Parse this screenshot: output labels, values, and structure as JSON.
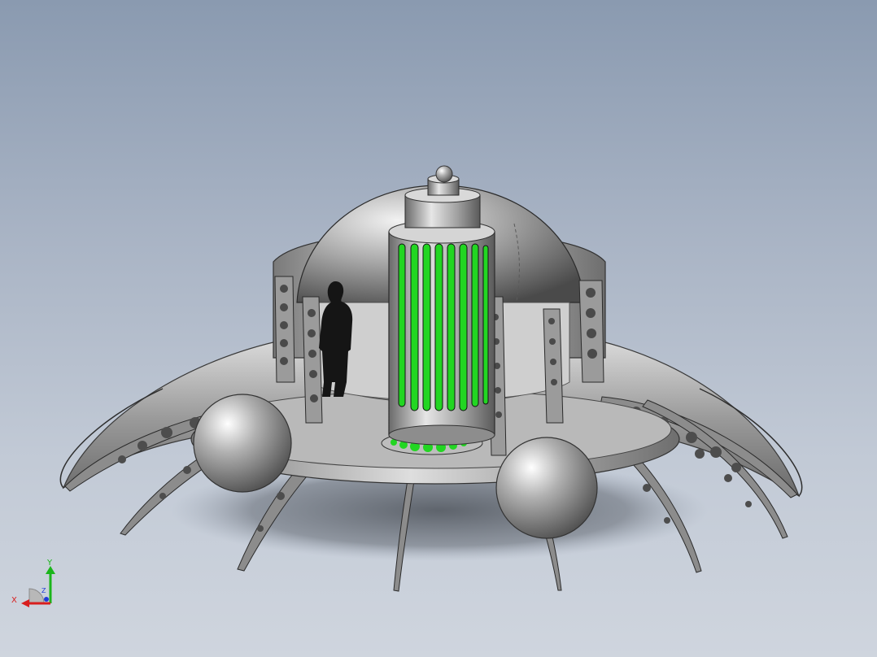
{
  "view": {
    "background_top": "#8a9ab0",
    "background_bottom": "#cfd5de",
    "model_color": "#8f8f8f",
    "core_glow_color": "#22d622"
  },
  "triad": {
    "x_label": "X",
    "y_label": "Y",
    "z_label": "Z",
    "x_color": "#d81e1e",
    "y_color": "#1bb51b",
    "z_color": "#1e3cd8"
  }
}
